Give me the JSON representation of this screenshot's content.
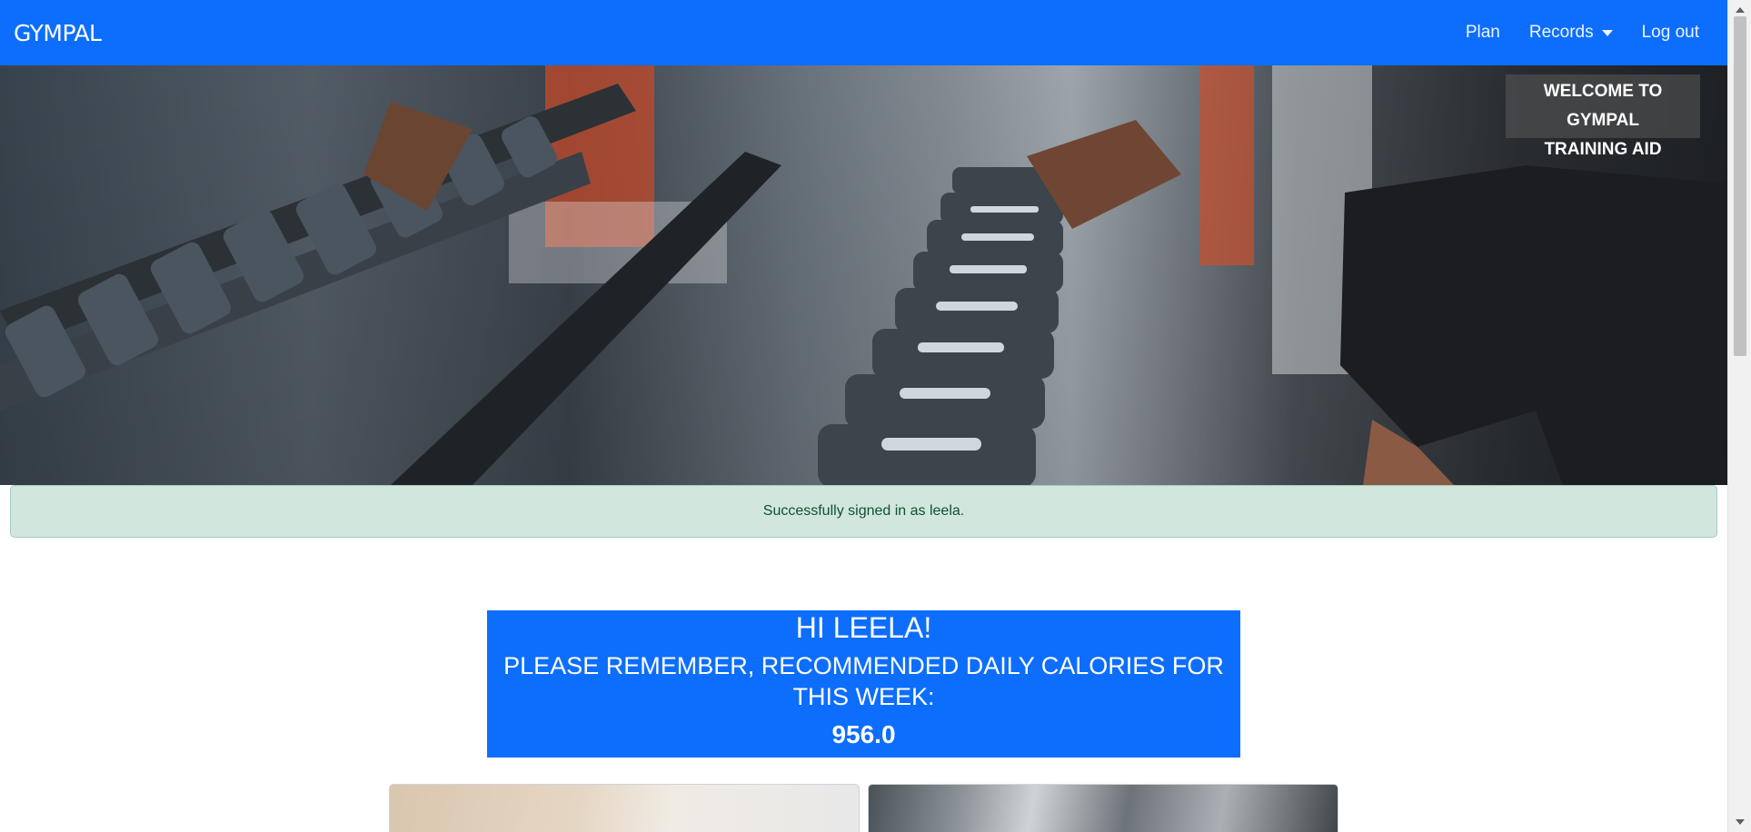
{
  "navbar": {
    "brand": "GYMPAL",
    "links": {
      "plan": "Plan",
      "records": "Records",
      "logout": "Log out"
    },
    "color": "#0d6efd"
  },
  "hero": {
    "welcome_line1": "WELCOME TO GYMPAL",
    "welcome_line2": "TRAINING AID"
  },
  "alert": {
    "message": "Successfully signed in as leela.",
    "color": "#d1e7dd"
  },
  "greeting": {
    "hi": "HI LEELA!",
    "message": "PLEASE REMEMBER, RECOMMENDED DAILY CALORIES FOR THIS WEEK:",
    "calories": "956.0"
  },
  "icons": {
    "records_caret": "chevron-down-icon",
    "scroll_up": "arrow-up-icon",
    "scroll_down": "arrow-down-icon"
  }
}
